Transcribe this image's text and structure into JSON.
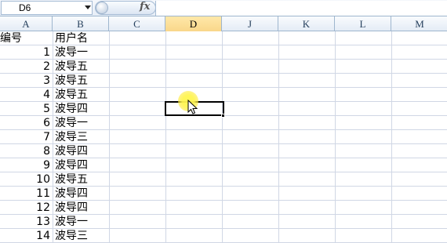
{
  "formula_bar": {
    "name_box": "D6",
    "fx_label": "fx",
    "formula_value": ""
  },
  "columns": [
    "A",
    "B",
    "C",
    "D",
    "J",
    "K",
    "L",
    "M"
  ],
  "active_column": "D",
  "rows": [
    {
      "a": "编号",
      "b": "用户名"
    },
    {
      "a": "1",
      "b": "波导一"
    },
    {
      "a": "2",
      "b": "波导五"
    },
    {
      "a": "3",
      "b": "波导五"
    },
    {
      "a": "4",
      "b": "波导五"
    },
    {
      "a": "5",
      "b": "波导四"
    },
    {
      "a": "6",
      "b": "波导一"
    },
    {
      "a": "7",
      "b": "波导三"
    },
    {
      "a": "8",
      "b": "波导四"
    },
    {
      "a": "9",
      "b": "波导四"
    },
    {
      "a": "10",
      "b": "波导五"
    },
    {
      "a": "11",
      "b": "波导四"
    },
    {
      "a": "12",
      "b": "波导四"
    },
    {
      "a": "13",
      "b": "波导一"
    },
    {
      "a": "14",
      "b": "波导三"
    }
  ],
  "selected_cell": "D6",
  "colors": {
    "grid_line": "#d0d7e5",
    "header_border": "#9eb6ce",
    "active_header": "#f9d78a",
    "cursor_highlight": "#fff150"
  }
}
